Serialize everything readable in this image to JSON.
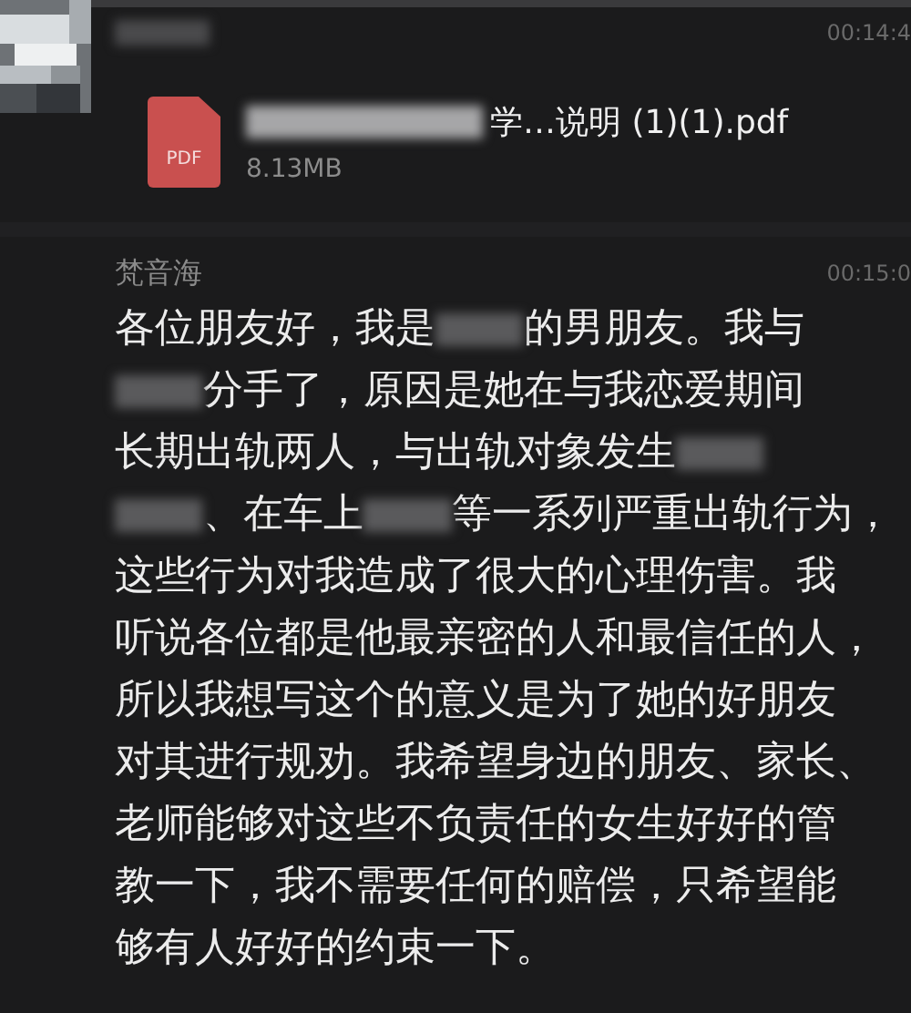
{
  "messages": [
    {
      "kind": "file",
      "sender": [
        {
          "kind": "redacted"
        }
      ],
      "time": "00:14:4",
      "file": {
        "type": "PDF",
        "name": [
          {
            "kind": "redacted"
          },
          {
            "kind": "text",
            "text": "学…说明 (1)(1).pdf"
          }
        ],
        "size": "8.13MB"
      }
    },
    {
      "kind": "text",
      "sender": [
        {
          "kind": "text",
          "text": "梵音海"
        }
      ],
      "time": "00:15:0",
      "lines": [
        [
          {
            "kind": "text",
            "text": "各位朋友好，我是"
          },
          {
            "kind": "redacted"
          },
          {
            "kind": "text",
            "text": "的男朋友。我与"
          }
        ],
        [
          {
            "kind": "redacted"
          },
          {
            "kind": "text",
            "text": "分手了，原因是她在与我恋爱期间"
          }
        ],
        [
          {
            "kind": "text",
            "text": "长期出轨两人，与出轨对象发生"
          },
          {
            "kind": "redacted"
          }
        ],
        [
          {
            "kind": "redacted"
          },
          {
            "kind": "text",
            "text": "、在车上"
          },
          {
            "kind": "redacted"
          },
          {
            "kind": "text",
            "text": "等一系列严重出轨行为，"
          }
        ],
        [
          {
            "kind": "text",
            "text": "这些行为对我造成了很大的心理伤害。我"
          }
        ],
        [
          {
            "kind": "text",
            "text": "听说各位都是他最亲密的人和最信任的人，"
          }
        ],
        [
          {
            "kind": "text",
            "text": "所以我想写这个的意义是为了她的好朋友"
          }
        ],
        [
          {
            "kind": "text",
            "text": "对其进行规劝。我希望身边的朋友、家长、"
          }
        ],
        [
          {
            "kind": "text",
            "text": "老师能够对这些不负责任的女生好好的管"
          }
        ],
        [
          {
            "kind": "text",
            "text": "教一下，我不需要任何的赔偿，只希望能"
          }
        ],
        [
          {
            "kind": "text",
            "text": "够有人好好的约束一下。"
          }
        ]
      ]
    }
  ]
}
